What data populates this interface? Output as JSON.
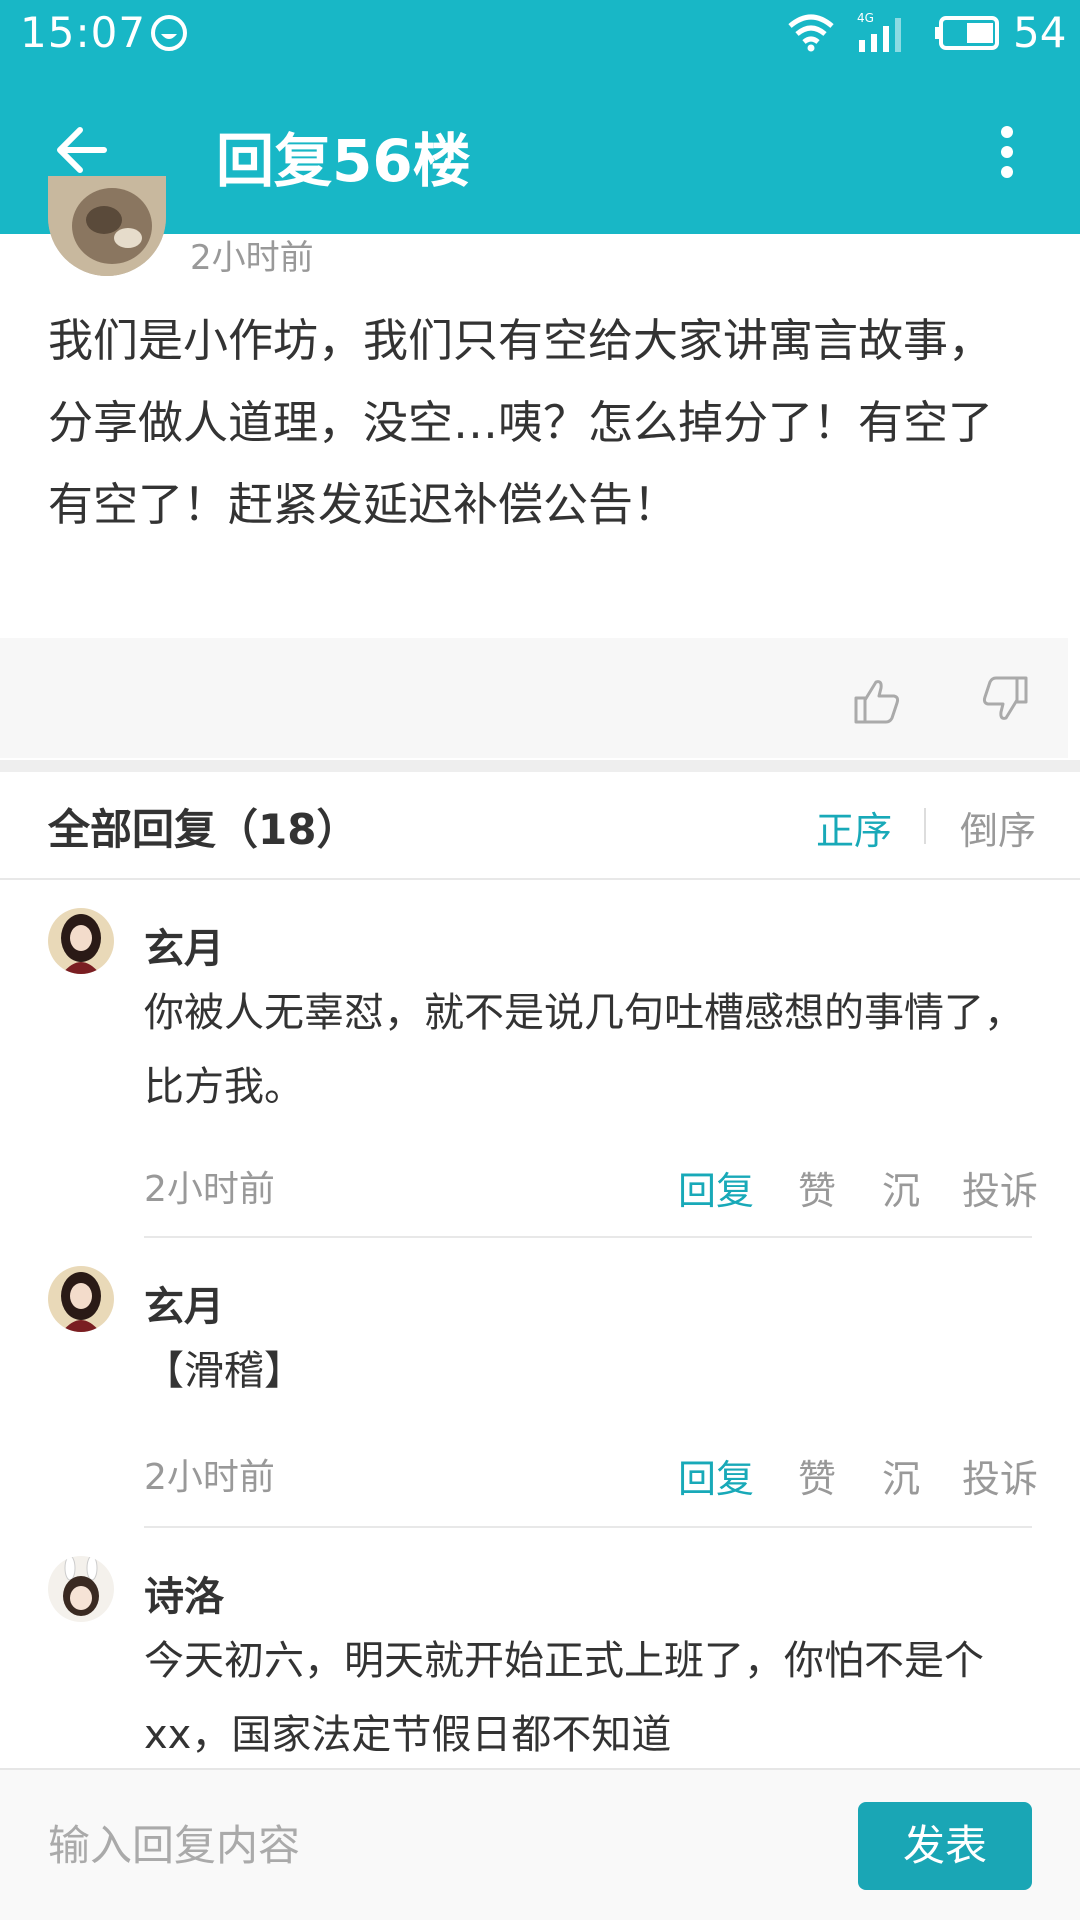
{
  "status_bar": {
    "time": "15:07",
    "battery": "54",
    "network": "4G"
  },
  "app_bar": {
    "title": "回复56楼"
  },
  "floor": {
    "time": "2小时前",
    "content": "我们是小作坊，我们只有空给大家讲寓言故事，分享做人道理，没空…咦？怎么掉分了！有空了有空了！赶紧发延迟补偿公告！"
  },
  "replies_header": {
    "label": "全部回复（18）",
    "sort_asc": "正序",
    "sort_desc": "倒序"
  },
  "actions": {
    "reply": "回复",
    "like": "赞",
    "sink": "沉",
    "report": "投诉"
  },
  "replies": [
    {
      "name": "玄月",
      "content": "你被人无辜怼，就不是说几句吐槽感想的事情了，比方我。",
      "time": "2小时前"
    },
    {
      "name": "玄月",
      "content": "【滑稽】",
      "time": "2小时前"
    },
    {
      "name": "诗洛",
      "content": "今天初六，明天就开始正式上班了，你怕不是个xx，国家法定节假日都不知道",
      "time": ""
    }
  ],
  "bottom_bar": {
    "placeholder": "输入回复内容",
    "send_label": "发表"
  },
  "colors": {
    "accent": "#18b7c6",
    "link": "#18a9b8"
  }
}
